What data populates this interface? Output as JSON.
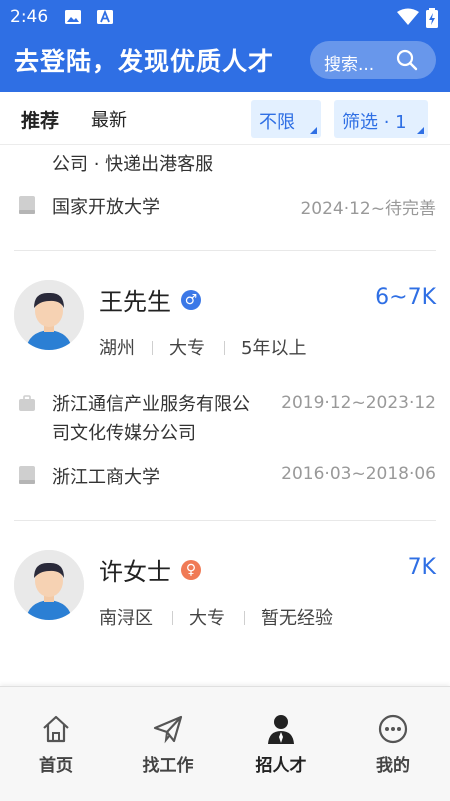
{
  "status_bar": {
    "time": "2:46"
  },
  "header": {
    "title": "去登陆，发现优质人才",
    "search_placeholder": "搜索..."
  },
  "tabs": [
    {
      "label": "推荐",
      "active": true
    },
    {
      "label": "最新",
      "active": false
    }
  ],
  "filters": {
    "region": "不限",
    "screen": "筛选 · 1"
  },
  "candidates": [
    {
      "partial": true,
      "experience_tail": "公司 · 快递出港客服",
      "education": {
        "school": "国家开放大学",
        "period": "2024·12~待完善"
      }
    },
    {
      "name": "王先生",
      "gender": "male",
      "gender_symbol": "♂",
      "salary": "6~7K",
      "location": "湖州",
      "degree": "大专",
      "experience_years": "5年以上",
      "work": {
        "company": "浙江通信产业服务有限公司文化传媒分公司",
        "company_line1": "浙江通信产业服务有限公",
        "company_line2": "司文化传媒分公司",
        "period": "2019·12~2023·12"
      },
      "education": {
        "school": "浙江工商大学",
        "period": "2016·03~2018·06"
      }
    },
    {
      "name": "许女士",
      "gender": "female",
      "gender_symbol": "♀",
      "salary": "7K",
      "location": "南浔区",
      "degree": "大专",
      "experience_years": "暂无经验"
    }
  ],
  "bottom_nav": [
    {
      "label": "首页",
      "icon": "home-icon",
      "active": false
    },
    {
      "label": "找工作",
      "icon": "paper-plane-icon",
      "active": false
    },
    {
      "label": "招人才",
      "icon": "recruit-person-icon",
      "active": true
    },
    {
      "label": "我的",
      "icon": "profile-dots-icon",
      "active": false
    }
  ],
  "colors": {
    "primary": "#2f6fe4",
    "male": "#3b78e7",
    "female": "#f07a55",
    "chip_bg": "#e3f0ff"
  }
}
